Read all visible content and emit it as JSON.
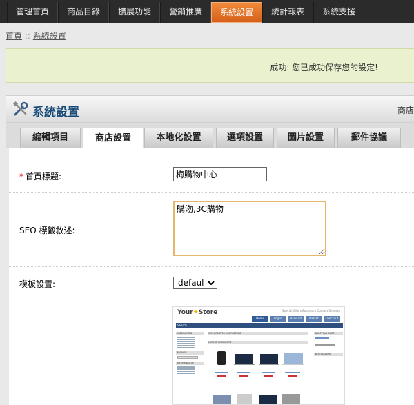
{
  "nav": {
    "items": [
      {
        "label": "管理首頁",
        "active": false
      },
      {
        "label": "商品目錄",
        "active": false
      },
      {
        "label": "擴展功能",
        "active": false
      },
      {
        "label": "營銷推廣",
        "active": false
      },
      {
        "label": "系統設置",
        "active": true
      },
      {
        "label": "統計報表",
        "active": false
      },
      {
        "label": "系統支援",
        "active": false
      }
    ]
  },
  "breadcrumb": {
    "home": "首頁",
    "separator": "::",
    "current": "系統設置"
  },
  "success": {
    "message": "成功: 您已成功保存您的設定!"
  },
  "panel": {
    "title": "系統設置",
    "right_text": "商店"
  },
  "tabs": [
    {
      "label": "編輯項目",
      "active": false
    },
    {
      "label": "商店設置",
      "active": true
    },
    {
      "label": "本地化設置",
      "active": false
    },
    {
      "label": "選項設置",
      "active": false
    },
    {
      "label": "圖片設置",
      "active": false
    },
    {
      "label": "郵件協議",
      "active": false
    }
  ],
  "form": {
    "homepage_title": {
      "label": "首頁標題:",
      "required_mark": "*",
      "value": "梅購物中心"
    },
    "seo_description": {
      "label": "SEO 標籤敘述:",
      "value": "購沕,3C購物"
    },
    "template": {
      "label": "模板設置:",
      "value": "default"
    }
  },
  "preview": {
    "logo_text": "Your",
    "logo_text2": "Store",
    "top_links": "Special Offers  Bookmark  Contact  Sitemap",
    "nav": [
      "Home",
      "Log In",
      "Account",
      "Basket",
      "Checkout"
    ],
    "search_label": "Search",
    "side_headers": [
      "CATEGORIES",
      "BRANDS",
      "INFORMATION"
    ],
    "main_headers": [
      "WELCOME TO YOUR STORE",
      "LATEST PRODUCTS"
    ],
    "right_headers": [
      "SHOPPING CART",
      "BESTSELLERS"
    ]
  },
  "colors": {
    "accent": "#e0742a",
    "title_blue": "#154a78",
    "success_bg": "#eaf1cf"
  }
}
